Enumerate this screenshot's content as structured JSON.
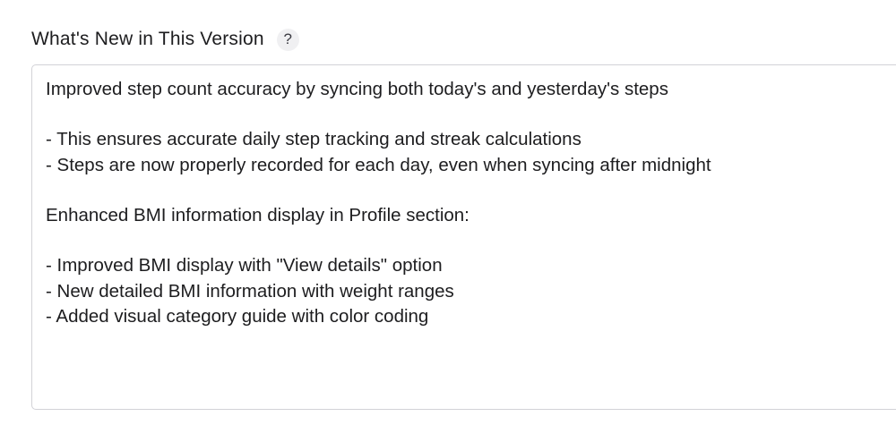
{
  "field": {
    "label": "What's New in This Version",
    "help_icon": "question-mark-icon",
    "help_glyph": "?"
  },
  "notes": {
    "value": "Improved step count accuracy by syncing both today's and yesterday's steps\n\n- This ensures accurate daily step tracking and streak calculations\n- Steps are now properly recorded for each day, even when syncing after midnight\n\nEnhanced BMI information display in Profile section:\n\n- Improved BMI display with \"View details\" option\n- New detailed BMI information with weight ranges\n- Added visual category guide with color coding"
  }
}
